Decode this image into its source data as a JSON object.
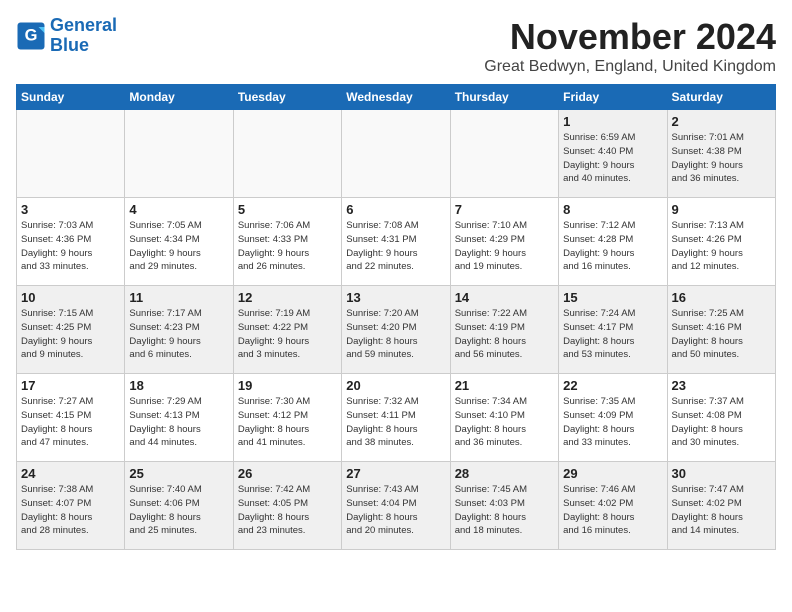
{
  "header": {
    "logo_line1": "General",
    "logo_line2": "Blue",
    "month": "November 2024",
    "location": "Great Bedwyn, England, United Kingdom"
  },
  "weekdays": [
    "Sunday",
    "Monday",
    "Tuesday",
    "Wednesday",
    "Thursday",
    "Friday",
    "Saturday"
  ],
  "weeks": [
    [
      {
        "day": "",
        "info": ""
      },
      {
        "day": "",
        "info": ""
      },
      {
        "day": "",
        "info": ""
      },
      {
        "day": "",
        "info": ""
      },
      {
        "day": "",
        "info": ""
      },
      {
        "day": "1",
        "info": "Sunrise: 6:59 AM\nSunset: 4:40 PM\nDaylight: 9 hours\nand 40 minutes."
      },
      {
        "day": "2",
        "info": "Sunrise: 7:01 AM\nSunset: 4:38 PM\nDaylight: 9 hours\nand 36 minutes."
      }
    ],
    [
      {
        "day": "3",
        "info": "Sunrise: 7:03 AM\nSunset: 4:36 PM\nDaylight: 9 hours\nand 33 minutes."
      },
      {
        "day": "4",
        "info": "Sunrise: 7:05 AM\nSunset: 4:34 PM\nDaylight: 9 hours\nand 29 minutes."
      },
      {
        "day": "5",
        "info": "Sunrise: 7:06 AM\nSunset: 4:33 PM\nDaylight: 9 hours\nand 26 minutes."
      },
      {
        "day": "6",
        "info": "Sunrise: 7:08 AM\nSunset: 4:31 PM\nDaylight: 9 hours\nand 22 minutes."
      },
      {
        "day": "7",
        "info": "Sunrise: 7:10 AM\nSunset: 4:29 PM\nDaylight: 9 hours\nand 19 minutes."
      },
      {
        "day": "8",
        "info": "Sunrise: 7:12 AM\nSunset: 4:28 PM\nDaylight: 9 hours\nand 16 minutes."
      },
      {
        "day": "9",
        "info": "Sunrise: 7:13 AM\nSunset: 4:26 PM\nDaylight: 9 hours\nand 12 minutes."
      }
    ],
    [
      {
        "day": "10",
        "info": "Sunrise: 7:15 AM\nSunset: 4:25 PM\nDaylight: 9 hours\nand 9 minutes."
      },
      {
        "day": "11",
        "info": "Sunrise: 7:17 AM\nSunset: 4:23 PM\nDaylight: 9 hours\nand 6 minutes."
      },
      {
        "day": "12",
        "info": "Sunrise: 7:19 AM\nSunset: 4:22 PM\nDaylight: 9 hours\nand 3 minutes."
      },
      {
        "day": "13",
        "info": "Sunrise: 7:20 AM\nSunset: 4:20 PM\nDaylight: 8 hours\nand 59 minutes."
      },
      {
        "day": "14",
        "info": "Sunrise: 7:22 AM\nSunset: 4:19 PM\nDaylight: 8 hours\nand 56 minutes."
      },
      {
        "day": "15",
        "info": "Sunrise: 7:24 AM\nSunset: 4:17 PM\nDaylight: 8 hours\nand 53 minutes."
      },
      {
        "day": "16",
        "info": "Sunrise: 7:25 AM\nSunset: 4:16 PM\nDaylight: 8 hours\nand 50 minutes."
      }
    ],
    [
      {
        "day": "17",
        "info": "Sunrise: 7:27 AM\nSunset: 4:15 PM\nDaylight: 8 hours\nand 47 minutes."
      },
      {
        "day": "18",
        "info": "Sunrise: 7:29 AM\nSunset: 4:13 PM\nDaylight: 8 hours\nand 44 minutes."
      },
      {
        "day": "19",
        "info": "Sunrise: 7:30 AM\nSunset: 4:12 PM\nDaylight: 8 hours\nand 41 minutes."
      },
      {
        "day": "20",
        "info": "Sunrise: 7:32 AM\nSunset: 4:11 PM\nDaylight: 8 hours\nand 38 minutes."
      },
      {
        "day": "21",
        "info": "Sunrise: 7:34 AM\nSunset: 4:10 PM\nDaylight: 8 hours\nand 36 minutes."
      },
      {
        "day": "22",
        "info": "Sunrise: 7:35 AM\nSunset: 4:09 PM\nDaylight: 8 hours\nand 33 minutes."
      },
      {
        "day": "23",
        "info": "Sunrise: 7:37 AM\nSunset: 4:08 PM\nDaylight: 8 hours\nand 30 minutes."
      }
    ],
    [
      {
        "day": "24",
        "info": "Sunrise: 7:38 AM\nSunset: 4:07 PM\nDaylight: 8 hours\nand 28 minutes."
      },
      {
        "day": "25",
        "info": "Sunrise: 7:40 AM\nSunset: 4:06 PM\nDaylight: 8 hours\nand 25 minutes."
      },
      {
        "day": "26",
        "info": "Sunrise: 7:42 AM\nSunset: 4:05 PM\nDaylight: 8 hours\nand 23 minutes."
      },
      {
        "day": "27",
        "info": "Sunrise: 7:43 AM\nSunset: 4:04 PM\nDaylight: 8 hours\nand 20 minutes."
      },
      {
        "day": "28",
        "info": "Sunrise: 7:45 AM\nSunset: 4:03 PM\nDaylight: 8 hours\nand 18 minutes."
      },
      {
        "day": "29",
        "info": "Sunrise: 7:46 AM\nSunset: 4:02 PM\nDaylight: 8 hours\nand 16 minutes."
      },
      {
        "day": "30",
        "info": "Sunrise: 7:47 AM\nSunset: 4:02 PM\nDaylight: 8 hours\nand 14 minutes."
      }
    ]
  ]
}
